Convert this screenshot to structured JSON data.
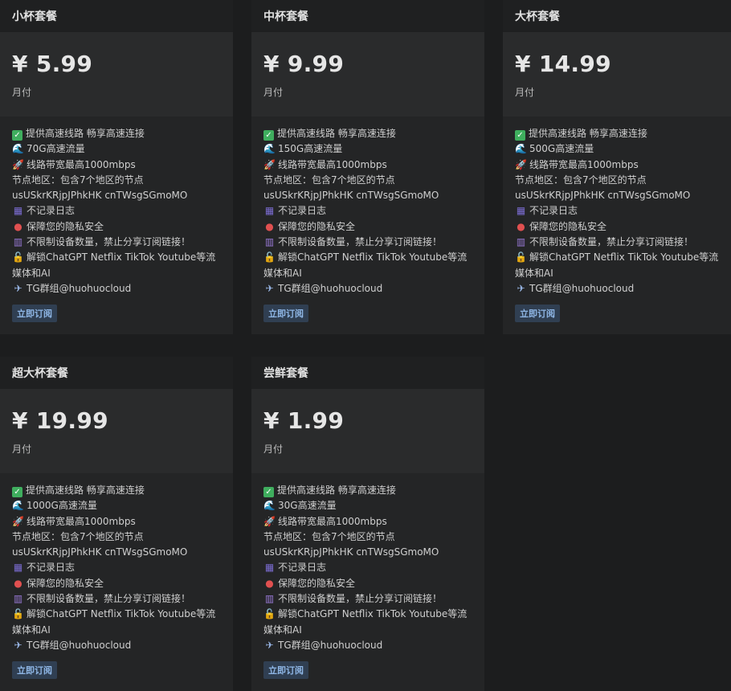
{
  "plans": [
    {
      "name": "小杯套餐",
      "price": "¥ 5.99",
      "period": "月付",
      "traffic": "70G高速流量"
    },
    {
      "name": "中杯套餐",
      "price": "¥ 9.99",
      "period": "月付",
      "traffic": "150G高速流量"
    },
    {
      "name": "大杯套餐",
      "price": "¥ 14.99",
      "period": "月付",
      "traffic": "500G高速流量"
    },
    {
      "name": "超大杯套餐",
      "price": "¥ 19.99",
      "period": "月付",
      "traffic": "1000G高速流量"
    },
    {
      "name": "尝鲜套餐",
      "price": "¥ 1.99",
      "period": "月付",
      "traffic": "30G高速流量"
    }
  ],
  "features": {
    "line1": "提供高速线路 畅享高速连接",
    "bandwidth": "线路带宽最高1000mbps",
    "region": "节点地区：包含7个地区的节点",
    "region_codes": "usUSkrKRjpJPhkHK cnTWsgSGmoMO",
    "no_log": "不记录日志",
    "privacy": "保障您的隐私安全",
    "devices": "不限制设备数量，禁止分享订阅链接！",
    "unlock": "解锁ChatGPT Netflix TikTok Youtube等流媒体和AI",
    "tg": "TG群组@huohuocloud"
  },
  "subscribe_label": "立即订阅",
  "icons": {
    "line1": "check-icon",
    "traffic": "wave-icon",
    "bandwidth": "rocket-icon",
    "no_log": "log-icon",
    "privacy": "shield-icon",
    "devices": "device-icon",
    "unlock": "unlock-icon",
    "tg": "plane-icon"
  }
}
